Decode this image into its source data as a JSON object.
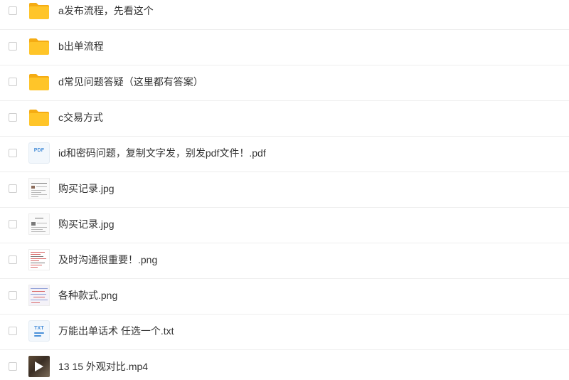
{
  "files": [
    {
      "name": "a发布流程，先看这个",
      "type": "folder",
      "icon": "folder-icon"
    },
    {
      "name": "b出单流程",
      "type": "folder",
      "icon": "folder-icon"
    },
    {
      "name": "d常见问题答疑（这里都有答案）",
      "type": "folder",
      "icon": "folder-icon"
    },
    {
      "name": "c交易方式",
      "type": "folder",
      "icon": "folder-icon"
    },
    {
      "name": "id和密码问题，复制文字发，别发pdf文件！.pdf",
      "type": "pdf",
      "icon": "pdf-file-icon",
      "badge": "PDF"
    },
    {
      "name": "购买记录.jpg",
      "type": "image",
      "icon": "image-thumbnail"
    },
    {
      "name": "购买记录.jpg",
      "type": "image",
      "icon": "image-thumbnail"
    },
    {
      "name": "及时沟通很重要！.png",
      "type": "image",
      "icon": "image-thumbnail"
    },
    {
      "name": "各种款式.png",
      "type": "image",
      "icon": "image-thumbnail"
    },
    {
      "name": "万能出单话术 任选一个.txt",
      "type": "txt",
      "icon": "txt-file-icon",
      "badge": "TXT"
    },
    {
      "name": "13 15 外观对比.mp4",
      "type": "video",
      "icon": "video-thumbnail"
    }
  ],
  "colors": {
    "folder": "#ffc529",
    "folder_back": "#f5ac13",
    "doc_accent": "#4a90d9",
    "text": "#333333",
    "divider": "#eeeeee"
  }
}
